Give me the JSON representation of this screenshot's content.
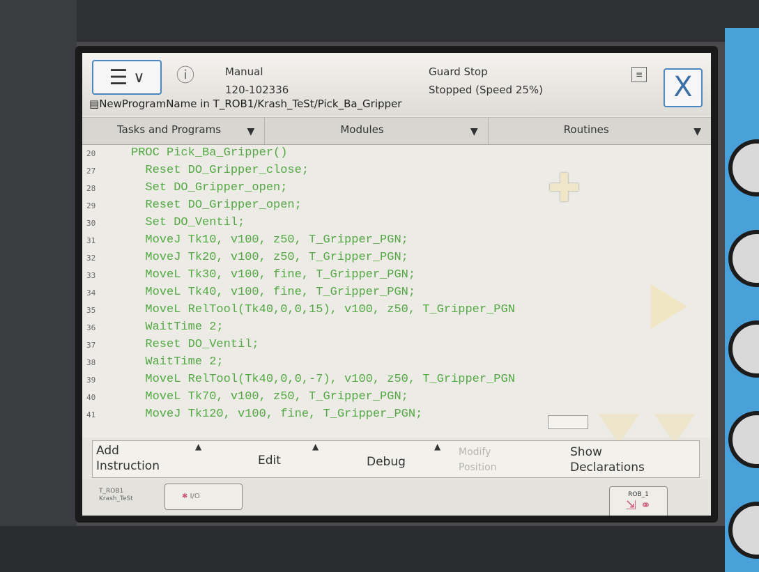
{
  "header": {
    "menu_icon": "hamburger-menu-icon",
    "mode": "Manual",
    "controller_id": "120-102336",
    "state_line1": "Guard Stop",
    "state_line2": "Stopped (Speed 25%)",
    "close_label": "X",
    "path": "NewProgramName in T_ROB1/Krash_TeSt/Pick_Ba_Gripper"
  },
  "tabs": [
    {
      "label": "Tasks and Programs"
    },
    {
      "label": "Modules"
    },
    {
      "label": "Routines"
    }
  ],
  "code": {
    "lines": [
      {
        "num": "20",
        "text": "PROC Pick_Ba_Gripper()"
      },
      {
        "num": "27",
        "text": "  Reset DO_Gripper_close;"
      },
      {
        "num": "28",
        "text": "  Set DO_Gripper_open;"
      },
      {
        "num": "29",
        "text": "  Reset DO_Gripper_open;"
      },
      {
        "num": "30",
        "text": "  Set DO_Ventil;"
      },
      {
        "num": "31",
        "text": "  MoveJ Tk10, v100, z50, T_Gripper_PGN;"
      },
      {
        "num": "32",
        "text": "  MoveJ Tk20, v100, z50, T_Gripper_PGN;"
      },
      {
        "num": "33",
        "text": "  MoveL Tk30, v100, fine, T_Gripper_PGN;"
      },
      {
        "num": "34",
        "text": "  MoveL Tk40, v100, fine, T_Gripper_PGN;"
      },
      {
        "num": "35",
        "text": "  MoveL RelTool(Tk40,0,0,15), v100, z50, T_Gripper_PGN"
      },
      {
        "num": "36",
        "text": "  WaitTime 2;"
      },
      {
        "num": "37",
        "text": "  Reset DO_Ventil;"
      },
      {
        "num": "38",
        "text": "  WaitTime 2;"
      },
      {
        "num": "39",
        "text": "  MoveL RelTool(Tk40,0,0,-7), v100, z50, T_Gripper_PGN"
      },
      {
        "num": "40",
        "text": "  MoveL Tk70, v100, z50, T_Gripper_PGN;"
      },
      {
        "num": "41",
        "text": "  MoveJ Tk120, v100, fine, T_Gripper_PGN;"
      }
    ]
  },
  "bottom_bar": {
    "add_instruction": "Add\nInstruction",
    "edit": "Edit",
    "debug": "Debug",
    "modify_position": "Modify\nPosition",
    "show_declarations": "Show\nDeclarations"
  },
  "status_bar": {
    "task_line1": "T_ROB1",
    "task_line2": "Krash_TeSt",
    "io_label": "I/O",
    "rob_label": "ROB_1"
  }
}
